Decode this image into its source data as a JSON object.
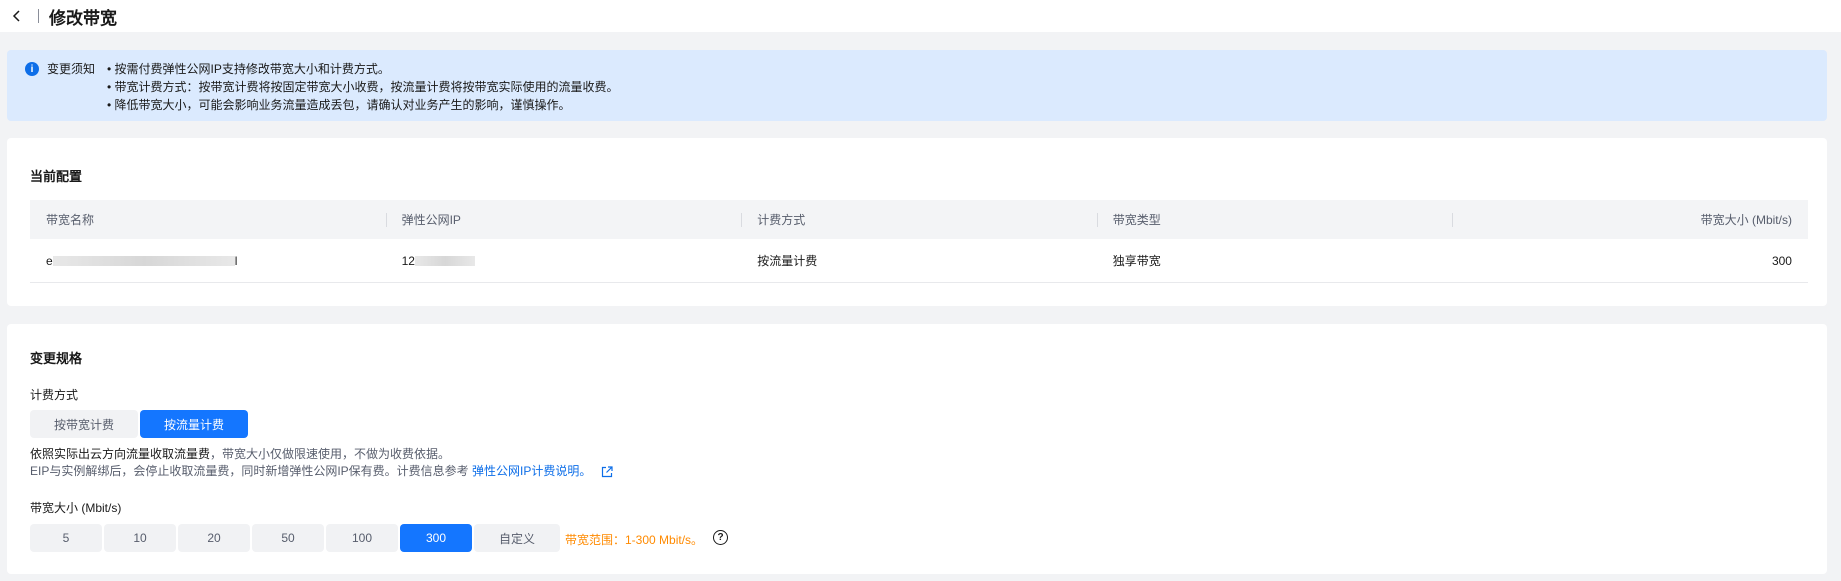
{
  "header": {
    "title": "修改带宽"
  },
  "notice": {
    "title": "变更须知",
    "items": [
      "按需付费弹性公网IP支持修改带宽大小和计费方式。",
      "带宽计费方式：按带宽计费将按固定带宽大小收费，按流量计费将按带宽实际使用的流量收费。",
      "降低带宽大小，可能会影响业务流量造成丢包，请确认对业务产生的影响，谨慎操作。"
    ]
  },
  "current": {
    "title": "当前配置",
    "columns": [
      "带宽名称",
      "弹性公网IP",
      "计费方式",
      "带宽类型",
      "带宽大小 (Mbit/s)"
    ],
    "row": {
      "name_prefix": "e",
      "name_suffix": "l",
      "ip_prefix": "12",
      "billing": "按流量计费",
      "type": "独享带宽",
      "size": "300"
    }
  },
  "change": {
    "title": "变更规格",
    "billing_label": "计费方式",
    "billing_options": [
      "按带宽计费",
      "按流量计费"
    ],
    "billing_selected": "按流量计费",
    "desc_strong": "依照实际出云方向流量收取流量费",
    "desc_rest": "，带宽大小仅做限速使用，不做为收费依据。",
    "desc_line2": "EIP与实例解绑后，会停止收取流量费，同时新增弹性公网IP保有费。计费信息参考",
    "desc_link": "弹性公网IP计费说明。",
    "bandwidth_label": "带宽大小 (Mbit/s)",
    "bandwidth_options": [
      "5",
      "10",
      "20",
      "50",
      "100",
      "300",
      "自定义"
    ],
    "bandwidth_selected": "300",
    "range_text": "带宽范围：1-300 Mbit/s。"
  },
  "colors": {
    "accent": "#1476ff",
    "notice_bg": "#dbeafe",
    "warning": "#ff8a00"
  }
}
